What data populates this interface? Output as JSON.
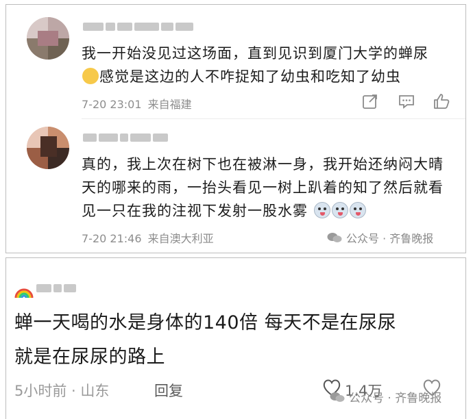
{
  "comments": [
    {
      "line1": "我一开始没见过这场面，直到见识到厦门大学的蝉尿",
      "line2": "感觉是这边的人不咋捉知了幼虫和吃知了幼虫",
      "time": "7-20 23:01",
      "location": "来自福建",
      "icons": [
        "share-icon",
        "comment-icon",
        "like-icon"
      ]
    },
    {
      "line1": "真的，我上次在树下也在被淋一身，我开始还纳闷大晴",
      "line2": "天的哪来的雨，一抬头看见一树上趴着的知了然后就看",
      "line3": "见一只在我的注视下发射一股水雾",
      "time": "7-20 21:46",
      "location": "来自澳大利亚",
      "watermark": "公众号 · 齐鲁晚报"
    }
  ],
  "second_post": {
    "line1": "蝉一天喝的水是身体的140倍 每天不是在尿尿",
    "line2": "就是在尿尿的路上",
    "time": "5小时前 · 山东",
    "reply": "回复",
    "likes": "1.4万",
    "watermark": "公众号 · 齐鲁晚报"
  }
}
